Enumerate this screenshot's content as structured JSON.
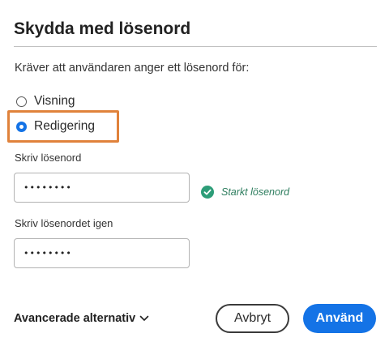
{
  "dialog": {
    "title": "Skydda med lösenord",
    "instruction": "Kräver att användaren anger ett lösenord för:"
  },
  "options": {
    "viewing_label": "Visning",
    "editing_label": "Redigering",
    "selected": "Redigering"
  },
  "password": {
    "label": "Skriv lösenord",
    "value": "••••••••",
    "strength_text": "Starkt lösenord"
  },
  "confirm": {
    "label": "Skriv lösenordet igen",
    "value": "••••••••"
  },
  "footer": {
    "advanced_label": "Avancerade alternativ",
    "cancel_label": "Avbryt",
    "apply_label": "Använd"
  },
  "colors": {
    "accent": "#1473e6",
    "highlight": "#e0823b",
    "success": "#2d9d78"
  }
}
